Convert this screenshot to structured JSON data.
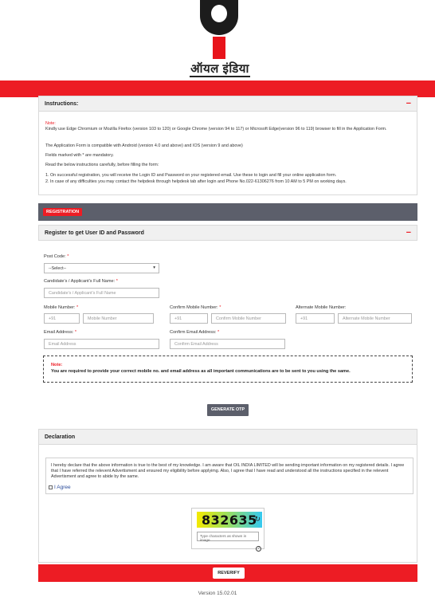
{
  "header": {
    "logo_text": "ऑयल इंडिया"
  },
  "instructions": {
    "title": "Instructions:",
    "note_label": "Note:",
    "browser_note": "Kindly use Edge Chromium or Mozilla Firefox (version 103 to 120) or Google Chrome (version 94 to 117) or Microsoft Edge(version 96 to 119) browser to fill in the Application Form.",
    "compat_note": "The Application Form is compatible with Android (version 4.0 and above) and IOS (version 9 and above)",
    "mandatory_note": "Fields marked with * are mandatory.",
    "read_note": "Read the below instructions carefully, before filling the form:",
    "item1": "1. On successful registration, you will receive the Login ID and Password on your registered email. Use these to login and fill your online application form.",
    "item2": "2. In case of any difficulties you may contact the helpdesk through helpdesk tab after login and Phone No.022-61306276 from 10 AM to 5 PM on working days."
  },
  "registration": {
    "tag_label": "REGISTRATION",
    "section_title": "Register to get User ID and Password",
    "post_code_label": "Post Code:",
    "post_code_value": "--Select--",
    "full_name_label": "Candidate's / Applicant's Full Name:",
    "full_name_placeholder": "Candidate's / Applicant's Full Name",
    "mobile_label": "Mobile Number:",
    "mobile_placeholder": "Mobile Number",
    "confirm_mobile_label": "Confirm Mobile Number:",
    "confirm_mobile_placeholder": "Confirm Mobile Number",
    "alt_mobile_label": "Alternate Mobile Number:",
    "alt_mobile_placeholder": "Alternate Mobile Number",
    "country_code": "+91",
    "email_label": "Email Address:",
    "email_placeholder": "Email Address",
    "confirm_email_label": "Confirm Email Address:",
    "confirm_email_placeholder": "Confirm Email Address",
    "note_label": "Note:",
    "note_text": "You are required to provide your correct mobile no. and email address as all important communications are to be sent to you using the same.",
    "generate_otp_label": "GENERATE OTP"
  },
  "declaration": {
    "title": "Declaration",
    "text": "I hereby declare that the above information is true to the best of my knowledge. I am aware that OIL INDIA LIMITED will be sending important information on my registered details. I agree that I have referred the relevent Advertisment and ensured my eligibility before applyimg. Also, I agree that I have read and understood all the instructions specified in the relevent Advertisment and agree to abide by the same.",
    "agree_label": "I Agree"
  },
  "captcha": {
    "code": "832635",
    "input_placeholder": "Type characters as shown in image",
    "help_glyph": "?",
    "refresh_glyph": "↻"
  },
  "footer": {
    "reverify_label": "REVERIFY",
    "version": "Version 15.02.01"
  },
  "symbols": {
    "collapse": "−",
    "required": "*",
    "dropdown": "▾"
  },
  "colors": {
    "brand_red": "#ed1c24",
    "bar_gray": "#5c5f6b"
  }
}
